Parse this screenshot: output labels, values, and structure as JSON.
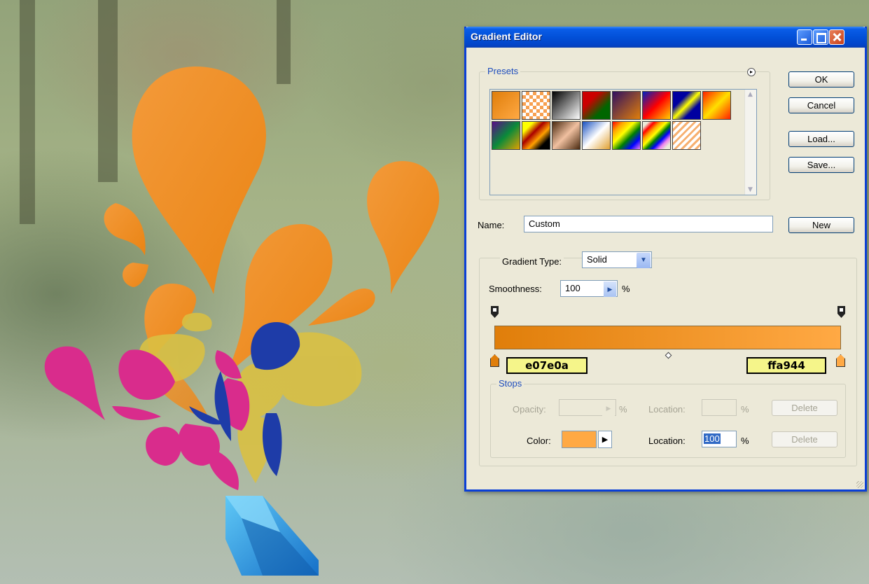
{
  "window": {
    "title": "Gradient Editor"
  },
  "presets": {
    "label": "Presets",
    "swatches": [
      "linear-gradient(135deg,#e07e0a,#ffa944)",
      "repeating-conic-gradient(#f7a050 0 25%,#fff 0 50%) 0 0/10px 10px",
      "linear-gradient(135deg,#000,#fff)",
      "linear-gradient(135deg,#c00 30%,#060 70%)",
      "linear-gradient(135deg,#301060,#e07e0a)",
      "linear-gradient(135deg,#0020c0,#ff0000 50%,#ffd000)",
      "linear-gradient(135deg,#0000a0 30%,#ffff00 50%,#0000a0 70%)",
      "linear-gradient(135deg,#ff2000,#ffe000 50%,#ff2000)",
      "linear-gradient(135deg,#5a0a8a,#0a8a3a 50%,#e0a000)",
      "linear-gradient(135deg,#ff0 20%,#a00 40%,#ffa000 60%,#000 80%)",
      "linear-gradient(135deg,#4a2a10,#f0c0a0 50%,#4a2a10)",
      "linear-gradient(135deg,#1850c0,#fff 50%,#e0a030)",
      "linear-gradient(135deg,red,orange,yellow,green,blue,violet)",
      "linear-gradient(135deg,transparent 10%,red,orange,yellow,green,blue,violet,transparent 90%)",
      "repeating-linear-gradient(135deg,#f7b070 0 3px,#fff 3px 7px)"
    ]
  },
  "buttons": {
    "ok": "OK",
    "cancel": "Cancel",
    "load": "Load...",
    "save": "Save...",
    "new": "New"
  },
  "name": {
    "label": "Name:",
    "value": "Custom"
  },
  "gradient_type": {
    "label": "Gradient Type:",
    "value": "Solid"
  },
  "smoothness": {
    "label": "Smoothness:",
    "value": "100",
    "unit": "%"
  },
  "stops_left_hex": "e07e0a",
  "stops_right_hex": "ffa944",
  "stops_group": {
    "label": "Stops",
    "opacity_label": "Opacity:",
    "opacity_unit": "%",
    "opacity_location_label": "Location:",
    "opacity_location_unit": "%",
    "opacity_delete": "Delete",
    "color_label": "Color:",
    "color_value": "#ffa944",
    "color_location_label": "Location:",
    "color_location_value": "100",
    "color_location_unit": "%",
    "color_delete": "Delete"
  }
}
